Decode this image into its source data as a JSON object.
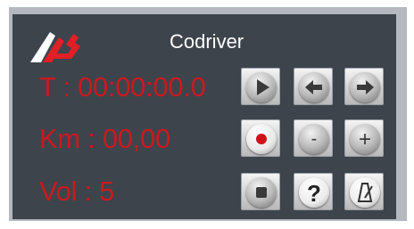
{
  "window": {
    "title": "Codriver"
  },
  "readouts": {
    "time": "T : 00:00:00.0",
    "distance": "Km : 00,00",
    "volume": "Vol : 5"
  },
  "colors": {
    "readout": "#c81a1f",
    "title": "#ffffff",
    "panel": "#3d444c",
    "frame": "#b3b9bf",
    "record_dot": "#d0101a"
  },
  "buttons": {
    "row1": [
      "play-icon",
      "arrow-left-icon",
      "arrow-right-icon"
    ],
    "row2": [
      "record-icon",
      "minus-icon",
      "plus-icon"
    ],
    "row3": [
      "stop-icon",
      "help-icon",
      "metronome-icon"
    ],
    "minus_glyph": "-",
    "plus_glyph": "+",
    "help_glyph": "?"
  }
}
